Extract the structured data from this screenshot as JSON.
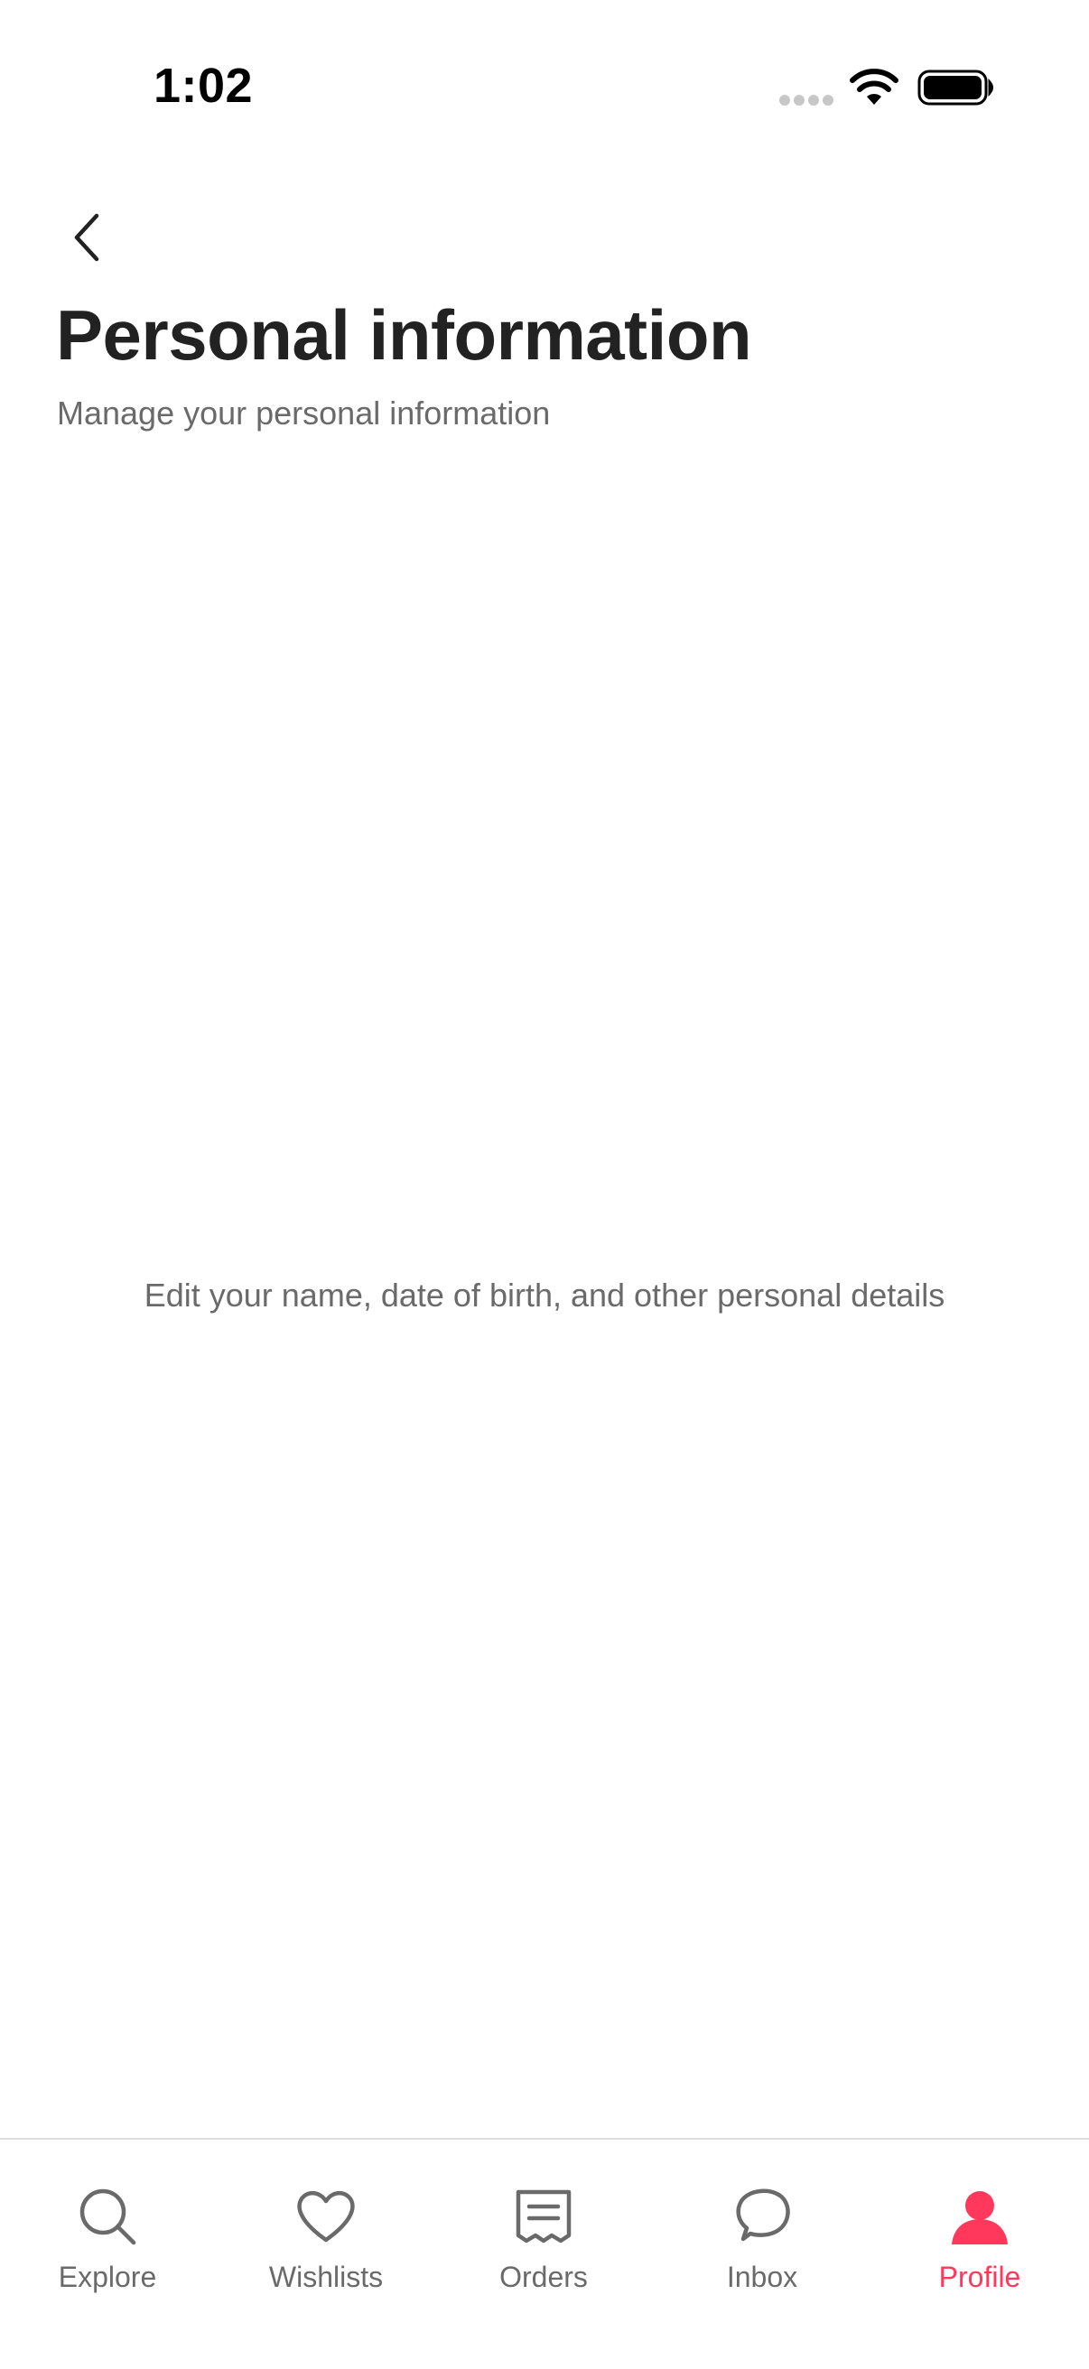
{
  "status_bar": {
    "time": "1:02"
  },
  "header": {
    "back_icon": "chevron-left-icon",
    "title": "Personal information",
    "subtitle": "Manage your personal information"
  },
  "main": {
    "message": "Edit your name, date of birth, and other personal details"
  },
  "tab_bar": {
    "active_color": "#ff385c",
    "inactive_color": "#6a6a6a",
    "items": [
      {
        "label": "Explore",
        "icon": "search-icon"
      },
      {
        "label": "Wishlists",
        "icon": "heart-icon"
      },
      {
        "label": "Orders",
        "icon": "receipt-icon"
      },
      {
        "label": "Inbox",
        "icon": "chat-bubble-icon"
      },
      {
        "label": "Profile",
        "icon": "person-icon",
        "active": true
      }
    ]
  }
}
